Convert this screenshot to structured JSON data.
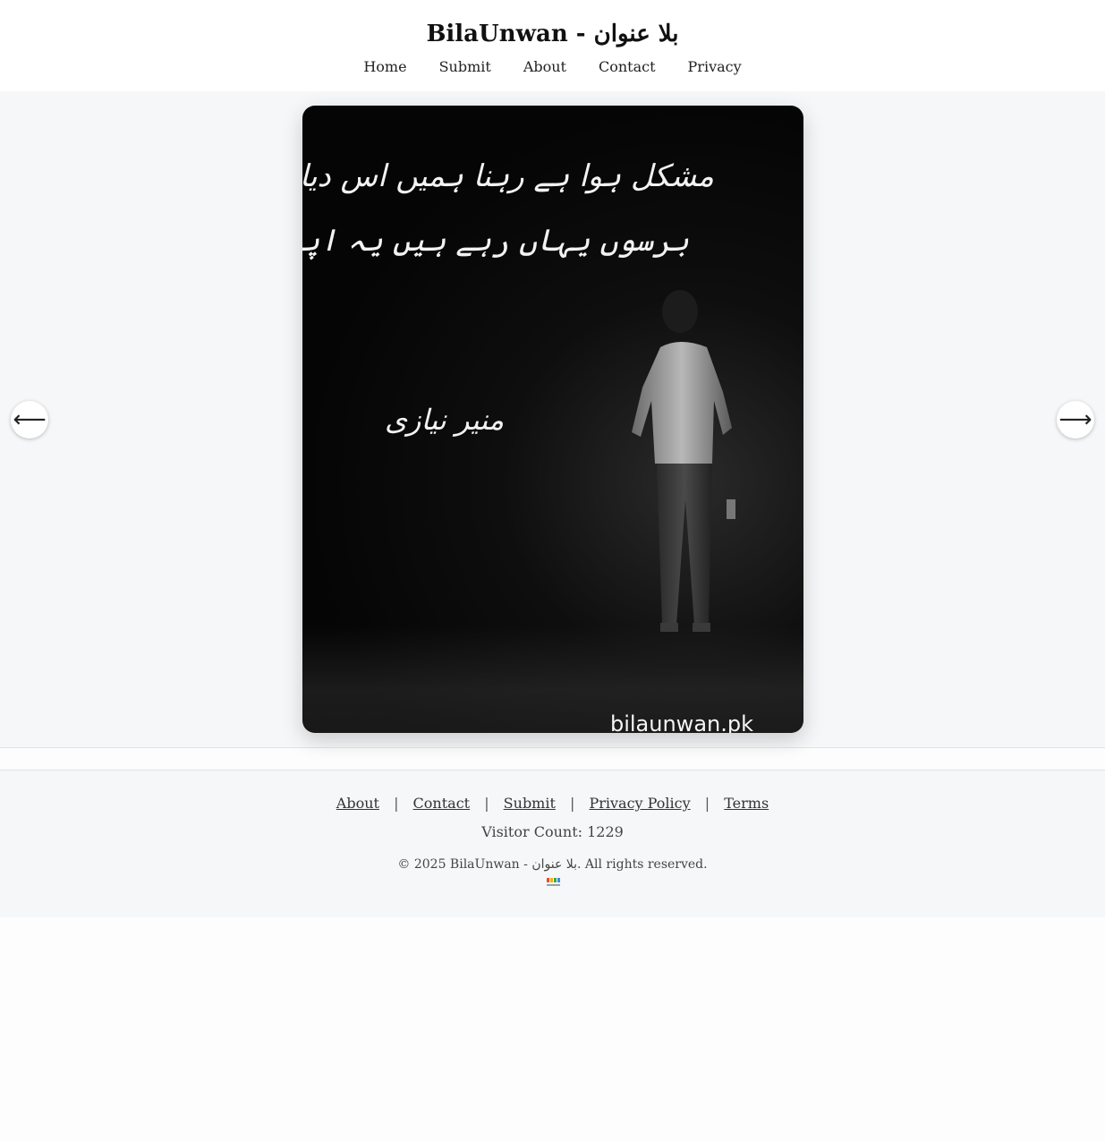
{
  "header": {
    "title": "BilaUnwan - بلا عنوان",
    "nav": [
      "Home",
      "Submit",
      "About",
      "Contact",
      "Privacy"
    ]
  },
  "card": {
    "couplet_line_1": "مشکل ہوا ہے رہنا ہمیں اس دیار میں",
    "couplet_line_2": "برسوں یہاں رہے ہیں یہ اپنا نہیں ہوا",
    "poet": "منیر نیازی",
    "watermark": "bilaunwan.pk"
  },
  "arrows": {
    "prev": "⟵",
    "next": "⟶"
  },
  "footer": {
    "links": [
      "About",
      "Contact",
      "Submit",
      "Privacy Policy",
      "Terms"
    ],
    "separator": "|",
    "visitor_count": "Visitor Count: 1229",
    "copyright": "© 2025 BilaUnwan - بلا عنوان. All rights reserved."
  },
  "colors": {
    "header_bg": "#ffffff",
    "viewer_bg": "#f6f7f9",
    "card_bg": "#0a0a0a",
    "text": "#333333"
  }
}
